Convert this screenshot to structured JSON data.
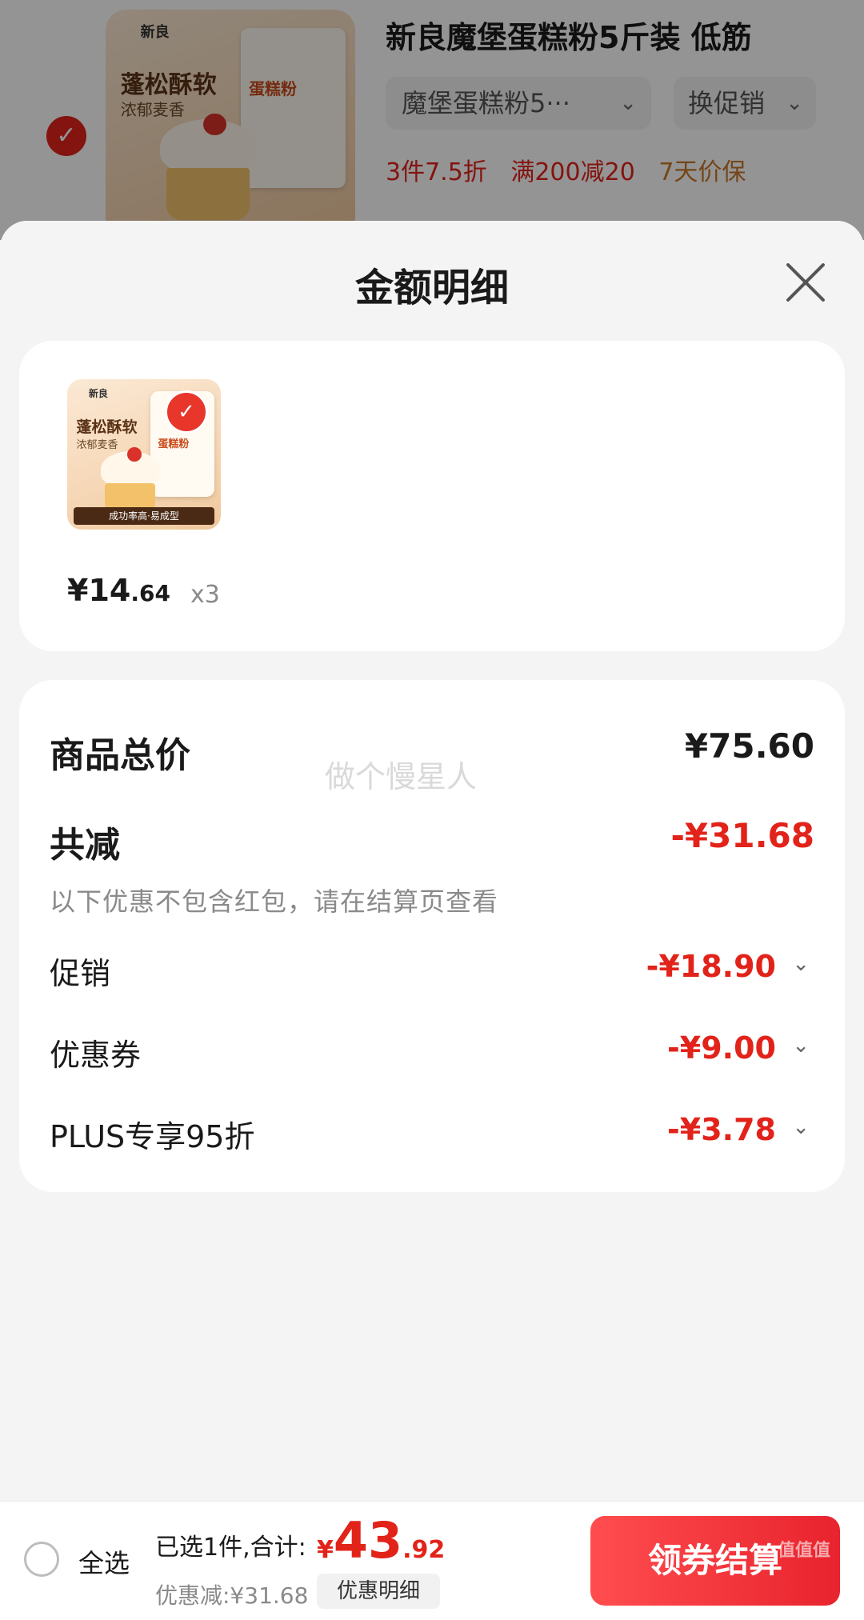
{
  "background_item": {
    "title": "新良魔堡蛋糕粉5斤装 低筋",
    "spec_select": "魔堡蛋糕粉5···",
    "promo_select": "换促销",
    "tags": [
      "3件7.5折",
      "满200减20",
      "7天价保"
    ],
    "image": {
      "brand": "新良",
      "headline": "蓬松酥软",
      "sub": "浓郁麦香",
      "bag_text": "蛋糕粉",
      "strip": "成功率高·易成型"
    }
  },
  "sheet": {
    "title": "金额明细",
    "close_icon": "close-icon"
  },
  "product": {
    "price_int": "¥14",
    "price_dec": ".64",
    "quantity": "x3",
    "image": {
      "brand": "新良",
      "headline": "蓬松酥软",
      "sub": "浓郁麦香",
      "bag_text": "蛋糕粉",
      "strip": "成功率高·易成型"
    }
  },
  "summary": {
    "total_label": "商品总价",
    "total_value": "¥75.60",
    "reduce_label": "共减",
    "reduce_value": "-¥31.68",
    "note": "以下优惠不包含红包，请在结算页查看",
    "lines": [
      {
        "label": "促销",
        "value": "-¥18.90"
      },
      {
        "label": "优惠券",
        "value": "-¥9.00"
      },
      {
        "label": "PLUS专享95折",
        "value": "-¥3.78"
      }
    ]
  },
  "watermark": "做个慢星人",
  "bottom": {
    "select_all": "全选",
    "selected_text": "已选1件,合计:",
    "total_yen": "¥",
    "total_int": "43",
    "total_dec": ".92",
    "discount_text": "优惠减:¥31.68",
    "detail_btn": "优惠明细",
    "checkout_btn": "领券结算",
    "corner_mark": "值值值"
  },
  "colors": {
    "accent_red": "#e2231a",
    "sheet_bg": "#f4f4f4",
    "card_bg": "#ffffff"
  }
}
